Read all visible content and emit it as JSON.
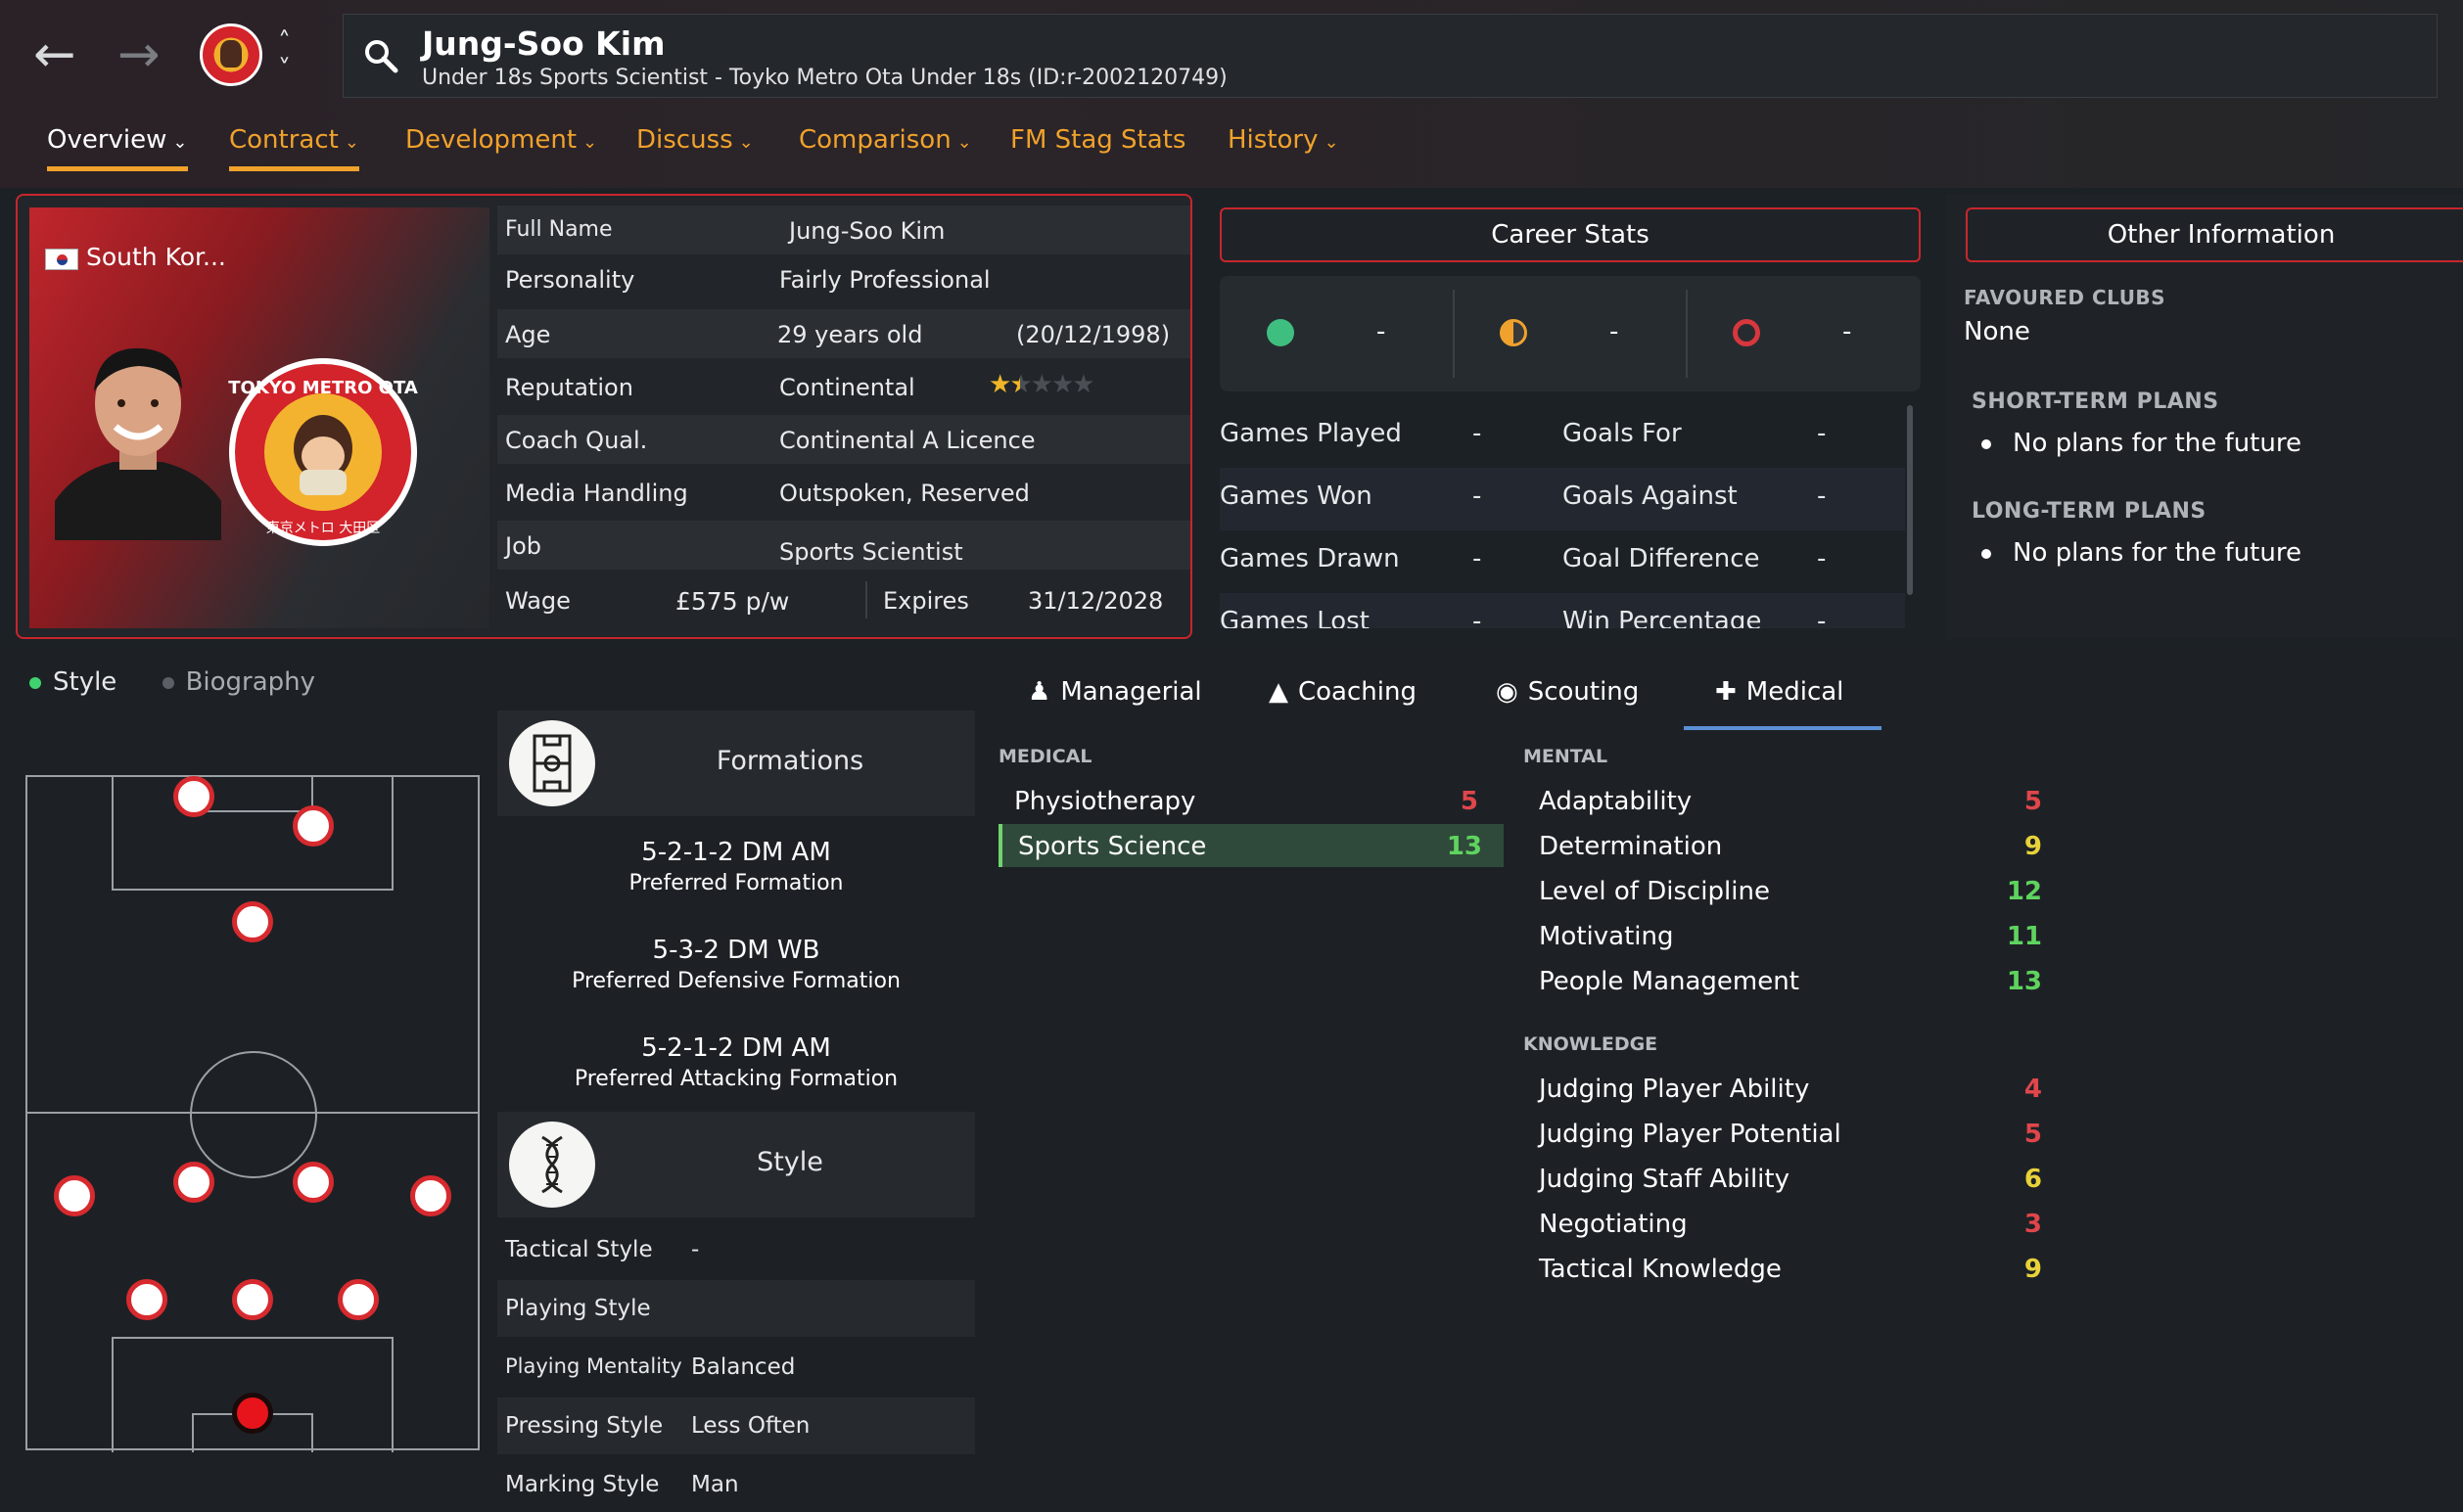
{
  "header": {
    "player_name": "Jung-Soo Kim",
    "subtitle": "Under 18s Sports Scientist - Toyko Metro Ota Under 18s (ID:r-2002120749)"
  },
  "tabs": [
    "Overview",
    "Contract",
    "Development",
    "Discuss",
    "Comparison",
    "FM Stag Stats",
    "History"
  ],
  "profile": {
    "nation": "South Kor...",
    "badge_text_top": "TOKYO METRO OTA",
    "badge_text_bottom": "東京メトロ 大田区",
    "rows": {
      "full_name_label": "Full Name",
      "full_name": "Jung-Soo Kim",
      "personality_label": "Personality",
      "personality": "Fairly Professional",
      "age_label": "Age",
      "age": "29 years old",
      "dob": "(20/12/1998)",
      "reputation_label": "Reputation",
      "reputation": "Continental",
      "reputation_stars": 1.5,
      "coach_label": "Coach Qual.",
      "coach": "Continental A Licence",
      "media_label": "Media Handling",
      "media": "Outspoken, Reserved",
      "job_label": "Job",
      "job": "Sports Scientist",
      "wage_label": "Wage",
      "wage": "£575 p/w",
      "expires_label": "Expires",
      "expires": "31/12/2028"
    }
  },
  "career": {
    "title": "Career Stats",
    "dash": "-",
    "icon_colors": [
      "#3fbf7f",
      "#f0a22c",
      "#d7373d"
    ],
    "rows": [
      {
        "left": "Games Played",
        "lval": "-",
        "right": "Goals For",
        "rval": "-"
      },
      {
        "left": "Games Won",
        "lval": "-",
        "right": "Goals Against",
        "rval": "-"
      },
      {
        "left": "Games Drawn",
        "lval": "-",
        "right": "Goal Difference",
        "rval": "-"
      },
      {
        "left": "Games Lost",
        "lval": "-",
        "right": "Win Percentage",
        "rval": "-"
      }
    ]
  },
  "other": {
    "title": "Other Information",
    "fav_label": "FAVOURED CLUBS",
    "fav": "None",
    "short_label": "SHORT-TERM PLANS",
    "short": "No plans for the future",
    "long_label": "LONG-TERM PLANS",
    "long": "No plans for the future"
  },
  "style_tabs": {
    "style": "Style",
    "biography": "Biography"
  },
  "formations": {
    "title": "Formations",
    "items": [
      {
        "name": "5-2-1-2 DM AM",
        "desc": "Preferred Formation"
      },
      {
        "name": "5-3-2 DM WB",
        "desc": "Preferred Defensive Formation"
      },
      {
        "name": "5-2-1-2 DM AM",
        "desc": "Preferred Attacking Formation"
      }
    ]
  },
  "style": {
    "title": "Style",
    "rows": [
      {
        "label": "Tactical Style",
        "value": "-"
      },
      {
        "label": "Playing Style",
        "value": ""
      },
      {
        "label": "Playing Mentality",
        "value": "Balanced"
      },
      {
        "label": "Pressing Style",
        "value": "Less Often"
      },
      {
        "label": "Marking Style",
        "value": "Man"
      }
    ]
  },
  "staff_tabs": [
    "Managerial",
    "Coaching",
    "Scouting",
    "Medical"
  ],
  "attributes": {
    "medical_label": "MEDICAL",
    "medical": [
      {
        "name": "Physiotherapy",
        "value": "5"
      },
      {
        "name": "Sports Science",
        "value": "13"
      }
    ],
    "mental_label": "MENTAL",
    "mental": [
      {
        "name": "Adaptability",
        "value": "5"
      },
      {
        "name": "Determination",
        "value": "9"
      },
      {
        "name": "Level of Discipline",
        "value": "12"
      },
      {
        "name": "Motivating",
        "value": "11"
      },
      {
        "name": "People Management",
        "value": "13"
      }
    ],
    "knowledge_label": "KNOWLEDGE",
    "knowledge": [
      {
        "name": "Judging Player Ability",
        "value": "4"
      },
      {
        "name": "Judging Player Potential",
        "value": "5"
      },
      {
        "name": "Judging Staff Ability",
        "value": "6"
      },
      {
        "name": "Negotiating",
        "value": "3"
      },
      {
        "name": "Tactical Knowledge",
        "value": "9"
      }
    ],
    "colors": {
      "low": "#e0464b",
      "mid": "#e8d23a",
      "high": "#5fd35f"
    }
  }
}
